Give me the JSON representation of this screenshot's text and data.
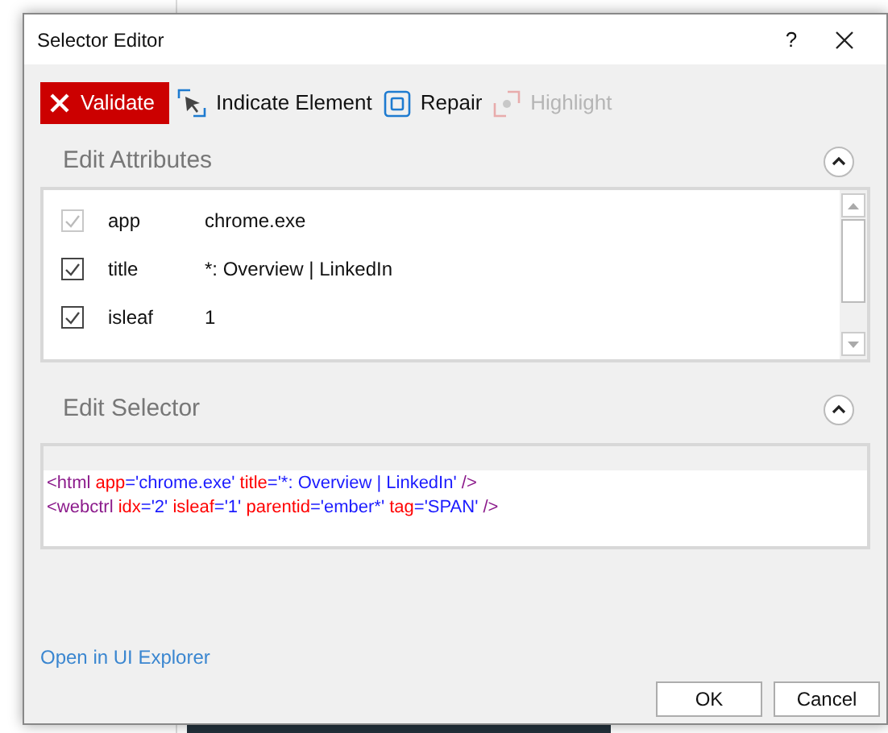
{
  "window": {
    "title": "Selector Editor",
    "help": "?"
  },
  "toolbar": [
    {
      "label": "Validate",
      "kind": "validate",
      "disabled": false
    },
    {
      "label": "Indicate Element",
      "kind": "indicate",
      "disabled": false
    },
    {
      "label": "Repair",
      "kind": "repair",
      "disabled": false
    },
    {
      "label": "Highlight",
      "kind": "highlight",
      "disabled": true
    }
  ],
  "attributes": {
    "title": "Edit Attributes",
    "expanded": true,
    "rows": [
      {
        "name": "app",
        "value": "chrome.exe",
        "checked": true,
        "disabled": true
      },
      {
        "name": "title",
        "value": "*: Overview | LinkedIn",
        "checked": true,
        "disabled": false
      },
      {
        "name": "isleaf",
        "value": "1",
        "checked": true,
        "disabled": false
      }
    ]
  },
  "selector": {
    "title": "Edit Selector",
    "expanded": true,
    "lines": [
      [
        {
          "text": "<html ",
          "kind": "tag"
        },
        {
          "text": "app",
          "kind": "attr"
        },
        {
          "text": "='chrome.exe' ",
          "kind": "value"
        },
        {
          "text": "title",
          "kind": "attr"
        },
        {
          "text": "='*: Overview | LinkedIn' ",
          "kind": "value"
        },
        {
          "text": "/>",
          "kind": "tag"
        }
      ],
      [
        {
          "text": "<webctrl ",
          "kind": "tag"
        },
        {
          "text": "idx",
          "kind": "attr"
        },
        {
          "text": "='2' ",
          "kind": "value"
        },
        {
          "text": "isleaf",
          "kind": "attr"
        },
        {
          "text": "='1' ",
          "kind": "value"
        },
        {
          "text": "parentid",
          "kind": "attr"
        },
        {
          "text": "='ember*' ",
          "kind": "value"
        },
        {
          "text": "tag",
          "kind": "attr"
        },
        {
          "text": "='SPAN' ",
          "kind": "value"
        },
        {
          "text": "/>",
          "kind": "tag"
        }
      ]
    ]
  },
  "link": "Open in UI Explorer",
  "buttons": [
    "OK",
    "Cancel"
  ]
}
